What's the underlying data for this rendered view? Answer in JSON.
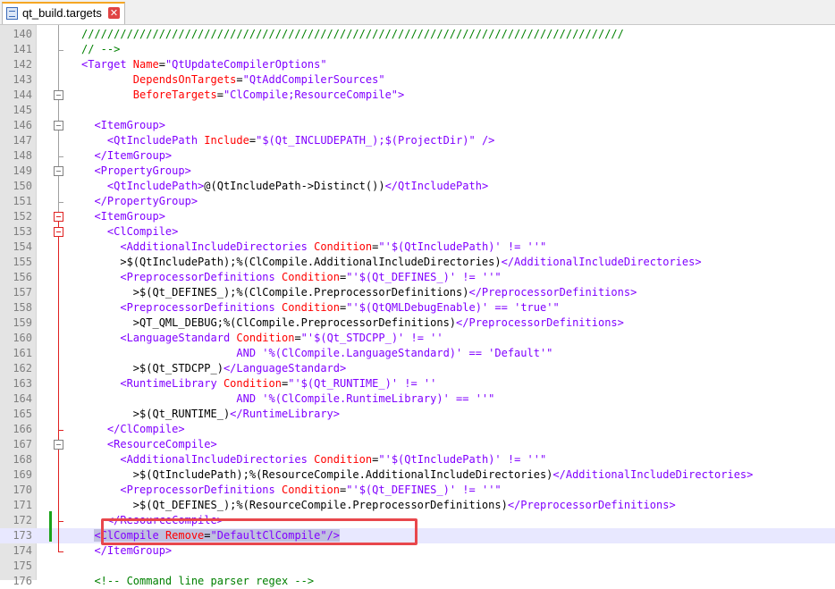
{
  "tab": {
    "title": "qt_build.targets",
    "icon": "file-xml-icon",
    "close_icon": "close-icon",
    "close_glyph": "✕"
  },
  "colors": {
    "tag": "#8000ff",
    "attribute": "#ff0000",
    "value": "#8000ff",
    "comment": "#008000",
    "highlight_box": "#e8474c",
    "fold_active": "#e02020",
    "change_bar": "#1aa31a"
  },
  "lines": [
    {
      "num": "140",
      "segs": [
        [
          "c",
          "////////////////////////////////////////////////////////////////////////////////////"
        ]
      ]
    },
    {
      "num": "141",
      "segs": [
        [
          "c",
          "// -->"
        ]
      ]
    },
    {
      "num": "142",
      "segs": [
        [
          "t",
          "<Target "
        ],
        [
          "a",
          "Name"
        ],
        [
          "x",
          "="
        ],
        [
          "v",
          "\"QtUpdateCompilerOptions\""
        ]
      ]
    },
    {
      "num": "143",
      "segs": [
        [
          "x",
          "        "
        ],
        [
          "a",
          "DependsOnTargets"
        ],
        [
          "x",
          "="
        ],
        [
          "v",
          "\"QtAddCompilerSources\""
        ]
      ]
    },
    {
      "num": "144",
      "segs": [
        [
          "x",
          "        "
        ],
        [
          "a",
          "BeforeTargets"
        ],
        [
          "x",
          "="
        ],
        [
          "v",
          "\"ClCompile;ResourceCompile\""
        ],
        [
          "t",
          ">"
        ]
      ]
    },
    {
      "num": "145",
      "segs": []
    },
    {
      "num": "146",
      "segs": [
        [
          "x",
          "  "
        ],
        [
          "t",
          "<ItemGroup>"
        ]
      ]
    },
    {
      "num": "147",
      "segs": [
        [
          "x",
          "    "
        ],
        [
          "t",
          "<QtIncludePath "
        ],
        [
          "a",
          "Include"
        ],
        [
          "x",
          "="
        ],
        [
          "v",
          "\"$(Qt_INCLUDEPATH_);$(ProjectDir)\""
        ],
        [
          "t",
          " />"
        ]
      ]
    },
    {
      "num": "148",
      "segs": [
        [
          "x",
          "  "
        ],
        [
          "t",
          "</ItemGroup>"
        ]
      ]
    },
    {
      "num": "149",
      "segs": [
        [
          "x",
          "  "
        ],
        [
          "t",
          "<PropertyGroup>"
        ]
      ]
    },
    {
      "num": "150",
      "segs": [
        [
          "x",
          "    "
        ],
        [
          "t",
          "<QtIncludePath>"
        ],
        [
          "x",
          "@(QtIncludePath->Distinct())"
        ],
        [
          "t",
          "</QtIncludePath>"
        ]
      ]
    },
    {
      "num": "151",
      "segs": [
        [
          "x",
          "  "
        ],
        [
          "t",
          "</PropertyGroup>"
        ]
      ]
    },
    {
      "num": "152",
      "segs": [
        [
          "x",
          "  "
        ],
        [
          "t",
          "<ItemGroup>"
        ]
      ]
    },
    {
      "num": "153",
      "segs": [
        [
          "x",
          "    "
        ],
        [
          "t",
          "<ClCompile>"
        ]
      ]
    },
    {
      "num": "154",
      "segs": [
        [
          "x",
          "      "
        ],
        [
          "t",
          "<AdditionalIncludeDirectories "
        ],
        [
          "a",
          "Condition"
        ],
        [
          "x",
          "="
        ],
        [
          "v",
          "\"'$(QtIncludePath)' != ''\""
        ]
      ]
    },
    {
      "num": "155",
      "segs": [
        [
          "x",
          "      >$(QtIncludePath);%(ClCompile.AdditionalIncludeDirectories)"
        ],
        [
          "t",
          "</AdditionalIncludeDirectories>"
        ]
      ]
    },
    {
      "num": "156",
      "segs": [
        [
          "x",
          "      "
        ],
        [
          "t",
          "<PreprocessorDefinitions "
        ],
        [
          "a",
          "Condition"
        ],
        [
          "x",
          "="
        ],
        [
          "v",
          "\"'$(Qt_DEFINES_)' != ''\""
        ]
      ]
    },
    {
      "num": "157",
      "segs": [
        [
          "x",
          "        >$(Qt_DEFINES_);%(ClCompile.PreprocessorDefinitions)"
        ],
        [
          "t",
          "</PreprocessorDefinitions>"
        ]
      ]
    },
    {
      "num": "158",
      "segs": [
        [
          "x",
          "      "
        ],
        [
          "t",
          "<PreprocessorDefinitions "
        ],
        [
          "a",
          "Condition"
        ],
        [
          "x",
          "="
        ],
        [
          "v",
          "\"'$(QtQMLDebugEnable)' == 'true'\""
        ]
      ]
    },
    {
      "num": "159",
      "segs": [
        [
          "x",
          "        >QT_QML_DEBUG;%(ClCompile.PreprocessorDefinitions)"
        ],
        [
          "t",
          "</PreprocessorDefinitions>"
        ]
      ]
    },
    {
      "num": "160",
      "segs": [
        [
          "x",
          "      "
        ],
        [
          "t",
          "<LanguageStandard "
        ],
        [
          "a",
          "Condition"
        ],
        [
          "x",
          "="
        ],
        [
          "v",
          "\"'$(Qt_STDCPP_)' != ''"
        ]
      ]
    },
    {
      "num": "161",
      "segs": [
        [
          "x",
          "                        "
        ],
        [
          "v",
          "AND '%(ClCompile.LanguageStandard)' == 'Default'\""
        ]
      ]
    },
    {
      "num": "162",
      "segs": [
        [
          "x",
          "        >$(Qt_STDCPP_)"
        ],
        [
          "t",
          "</LanguageStandard>"
        ]
      ]
    },
    {
      "num": "163",
      "segs": [
        [
          "x",
          "      "
        ],
        [
          "t",
          "<RuntimeLibrary "
        ],
        [
          "a",
          "Condition"
        ],
        [
          "x",
          "="
        ],
        [
          "v",
          "\"'$(Qt_RUNTIME_)' != ''"
        ]
      ]
    },
    {
      "num": "164",
      "segs": [
        [
          "x",
          "                        "
        ],
        [
          "v",
          "AND '%(ClCompile.RuntimeLibrary)' == ''\""
        ]
      ]
    },
    {
      "num": "165",
      "segs": [
        [
          "x",
          "        >$(Qt_RUNTIME_)"
        ],
        [
          "t",
          "</RuntimeLibrary>"
        ]
      ]
    },
    {
      "num": "166",
      "segs": [
        [
          "x",
          "    "
        ],
        [
          "t",
          "</ClCompile>"
        ]
      ]
    },
    {
      "num": "167",
      "segs": [
        [
          "x",
          "    "
        ],
        [
          "t",
          "<ResourceCompile>"
        ]
      ]
    },
    {
      "num": "168",
      "segs": [
        [
          "x",
          "      "
        ],
        [
          "t",
          "<AdditionalIncludeDirectories "
        ],
        [
          "a",
          "Condition"
        ],
        [
          "x",
          "="
        ],
        [
          "v",
          "\"'$(QtIncludePath)' != ''\""
        ]
      ]
    },
    {
      "num": "169",
      "segs": [
        [
          "x",
          "        >$(QtIncludePath);%(ResourceCompile.AdditionalIncludeDirectories)"
        ],
        [
          "t",
          "</AdditionalIncludeDirectories>"
        ]
      ]
    },
    {
      "num": "170",
      "segs": [
        [
          "x",
          "      "
        ],
        [
          "t",
          "<PreprocessorDefinitions "
        ],
        [
          "a",
          "Condition"
        ],
        [
          "x",
          "="
        ],
        [
          "v",
          "\"'$(Qt_DEFINES_)' != ''\""
        ]
      ]
    },
    {
      "num": "171",
      "segs": [
        [
          "x",
          "        >$(Qt_DEFINES_);%(ResourceCompile.PreprocessorDefinitions)"
        ],
        [
          "t",
          "</PreprocessorDefinitions>"
        ]
      ]
    },
    {
      "num": "172",
      "segs": [
        [
          "x",
          "    "
        ],
        [
          "t",
          "</ResourceCompile>"
        ]
      ]
    },
    {
      "num": "173",
      "current": true,
      "segs": [
        [
          "x",
          "  "
        ],
        [
          "t",
          "<ClCompile "
        ],
        [
          "a",
          "Remove"
        ],
        [
          "x",
          "="
        ],
        [
          "v",
          "\"DefaultClCompile\""
        ],
        [
          "t",
          "/>"
        ]
      ]
    },
    {
      "num": "174",
      "segs": [
        [
          "x",
          "  "
        ],
        [
          "t",
          "</ItemGroup>"
        ]
      ]
    },
    {
      "num": "175",
      "segs": []
    },
    {
      "num": "176",
      "segs": [
        [
          "x",
          "  "
        ],
        [
          "c",
          "<!-- Command line parser regex -->"
        ]
      ]
    }
  ]
}
